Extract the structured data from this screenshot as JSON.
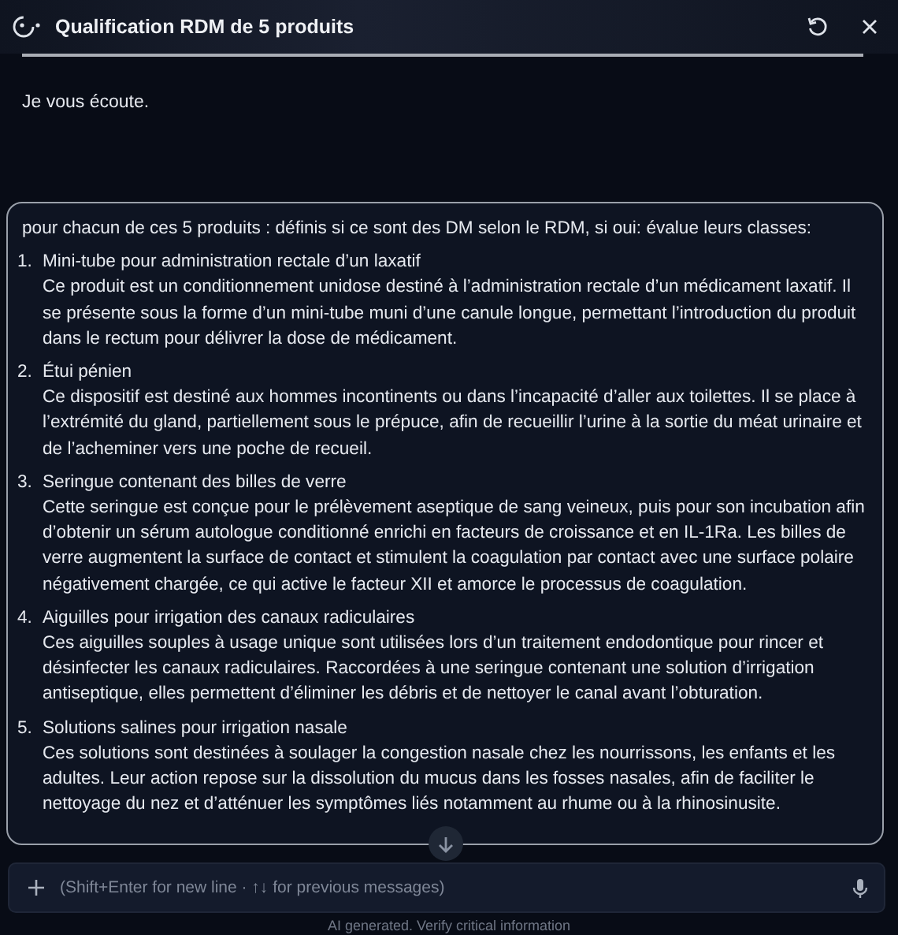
{
  "header": {
    "title": "Qualification RDM de 5 produits"
  },
  "assistant_message": "Je vous écoute.",
  "user_message": {
    "intro": "pour chacun de ces 5 produits : définis si ce sont des DM selon le RDM, si oui: évalue leurs classes:",
    "items": [
      {
        "number": "1.",
        "title": "Mini-tube pour administration rectale d’un laxatif",
        "text": "Ce produit est un conditionnement unidose destiné à l’administration rectale d’un médicament laxatif. Il se présente sous la forme d’un mini-tube muni d’une canule longue, permettant l’introduction du produit dans le rectum pour délivrer la dose de médicament."
      },
      {
        "number": "2.",
        "title": "Étui pénien",
        "text": "Ce dispositif est destiné aux hommes incontinents ou dans l’incapacité d’aller aux toilettes. Il se place à l’extrémité du gland, partiellement sous le prépuce, afin de recueillir l’urine à la sortie du méat urinaire et de l’acheminer vers une poche de recueil."
      },
      {
        "number": "3.",
        "title": "Seringue contenant des billes de verre",
        "text": "Cette seringue est conçue pour le prélèvement aseptique de sang veineux, puis pour son incubation afin d’obtenir un sérum autologue conditionné enrichi en facteurs de croissance et en IL-1Ra. Les billes de verre augmentent la surface de contact et stimulent la coagulation par contact avec une surface polaire négativement chargée, ce qui active le facteur XII et amorce le processus de coagulation."
      },
      {
        "number": "4.",
        "title": "Aiguilles pour irrigation des canaux radiculaires",
        "text": "Ces aiguilles souples à usage unique sont utilisées lors d’un traitement endodontique pour rincer et désinfecter les canaux radiculaires. Raccordées à une seringue contenant une solution d’irrigation antiseptique, elles permettent d’éliminer les débris et de nettoyer le canal avant l’obturation."
      },
      {
        "number": "5.",
        "title": "Solutions salines pour irrigation nasale",
        "text": "Ces solutions sont destinées à soulager la congestion nasale chez les nourrissons, les enfants et les adultes. Leur action repose sur la dissolution du mucus dans les fosses nasales, afin de faciliter le nettoyage du nez et d’atténuer les symptômes liés notamment au rhume ou à la rhinosinusite."
      }
    ]
  },
  "composer": {
    "placeholder": "(Shift+Enter for new line · ↑↓ for previous messages)"
  },
  "footer": "AI generated. Verify critical information"
}
